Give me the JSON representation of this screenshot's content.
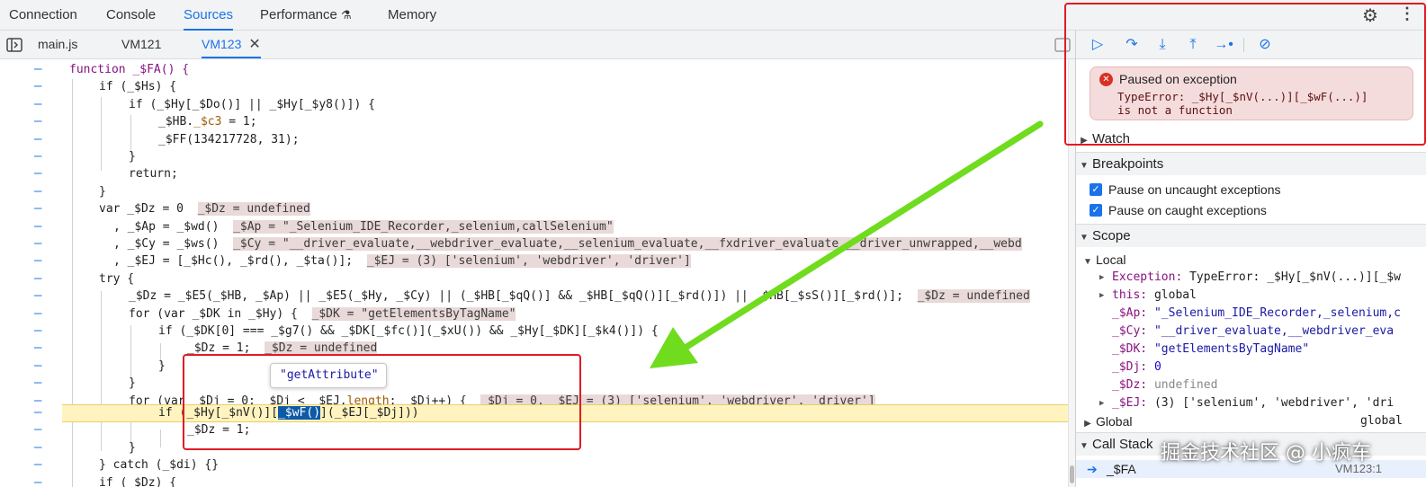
{
  "top_tabs": [
    "Connection",
    "Console",
    "Sources",
    "Performance",
    "Memory"
  ],
  "file_tabs": [
    "main.js",
    "VM121",
    "VM123"
  ],
  "debugger_icons": [
    "resume-icon",
    "step-over-icon",
    "step-into-icon",
    "step-out-icon",
    "step-icon",
    "deactivate-breakpoints-icon"
  ],
  "exception": {
    "title": "Paused on exception",
    "message_line1": "TypeError: _$Hy[_$nV(...)][_$wF(...)]",
    "message_line2": "is not a function"
  },
  "sections": {
    "watch": "Watch",
    "breakpoints": "Breakpoints",
    "scope": "Scope",
    "local": "Local",
    "global": "Global",
    "call_stack": "Call Stack"
  },
  "breakpoint_options": [
    {
      "label": "Pause on uncaught exceptions",
      "checked": true
    },
    {
      "label": "Pause on caught exceptions",
      "checked": true
    }
  ],
  "scope_vars": {
    "exception": {
      "key": "Exception:",
      "value": "TypeError: _$Hy[_$nV(...)][_$w"
    },
    "this": {
      "key": "this:",
      "value": "global"
    },
    "ap": {
      "key": "_$Ap:",
      "value": "\"_Selenium_IDE_Recorder,_selenium,c"
    },
    "cy": {
      "key": "_$Cy:",
      "value": "\"__driver_evaluate,__webdriver_eva"
    },
    "dk": {
      "key": "_$DK:",
      "value": "\"getElementsByTagName\""
    },
    "dj": {
      "key": "_$Dj:",
      "value": "0"
    },
    "dz": {
      "key": "_$Dz:",
      "value": "undefined"
    },
    "ej": {
      "key": "_$EJ:",
      "value": "(3) ['selenium', 'webdriver', 'dri"
    }
  },
  "global_value": "global",
  "call_stack": {
    "fn": "_$FA",
    "location": "VM123:1"
  },
  "tooltip": "\"getAttribute\"",
  "watermark": "掘金技术社区 @ 小疯车",
  "code": {
    "l0": "function _$FA() {",
    "l1": "if (_$Hs) {",
    "l2": "if (_$Hy[_$Do()] || _$Hy[_$y8()]) {",
    "l3a": "_$HB.",
    "l3b": "_$c3",
    "l3c": " = 1;",
    "l4": "_$FF(134217728, 31);",
    "l5": "}",
    "l6": "return;",
    "l7": "}",
    "l8a": "var _$Dz = 0",
    "l8b": "_$Dz = undefined",
    "l9a": ", _$Ap = _$wd()",
    "l9b": "_$Ap = \"_Selenium_IDE_Recorder,_selenium,callSelenium\"",
    "l10a": ", _$Cy = _$ws()",
    "l10b": "_$Cy = \"__driver_evaluate,__webdriver_evaluate,__selenium_evaluate,__fxdriver_evaluate,__driver_unwrapped,__webd",
    "l11a": ", _$EJ = [_$Hc(), _$rd(), _$ta()];",
    "l11b": "_$EJ = (3) ['selenium', 'webdriver', 'driver']",
    "l12": "try {",
    "l13a": "_$Dz = _$E5(_$HB, _$Ap) || _$E5(_$Hy, _$Cy) || (_$HB[_$qQ()] && _$HB[_$qQ()][_$rd()]) || _$HB[_$sS()][_$rd()];",
    "l13b": "_$Dz = undefined",
    "l14a": "for (var _$DK in _$Hy) {",
    "l14b": "_$DK = \"getElementsByTagName\"",
    "l15": "if (_$DK[0] === _$g7() && _$DK[_$fc()](_$xU()) && _$Hy[_$DK][_$k4()]) {",
    "l16a": "_$Dz = 1;",
    "l16b": "_$Dz = undefined",
    "l17": "}",
    "l18": "}",
    "l19a": "for (var _$Dj = 0; _$Dj < _$EJ.",
    "l19p": "length",
    "l19c": "; _$Dj++) {",
    "l19b": "_$Dj = 0, _$EJ = (3) ['selenium', 'webdriver', 'driver']",
    "l20a": "if (_$Hy[_$nV()][",
    "l20b": "_$wF()",
    "l20c": "](_$EJ[_$Dj]))",
    "l21": "_$Dz = 1;",
    "l22": "}",
    "l23": "} catch (_$di) {}",
    "l24": "if (_$Dz) {"
  },
  "colors": {
    "accent": "#1a73e8",
    "highlight_box": "#e01b24",
    "arrow": "#6fdc1e",
    "exec_line": "#fff3bf"
  }
}
